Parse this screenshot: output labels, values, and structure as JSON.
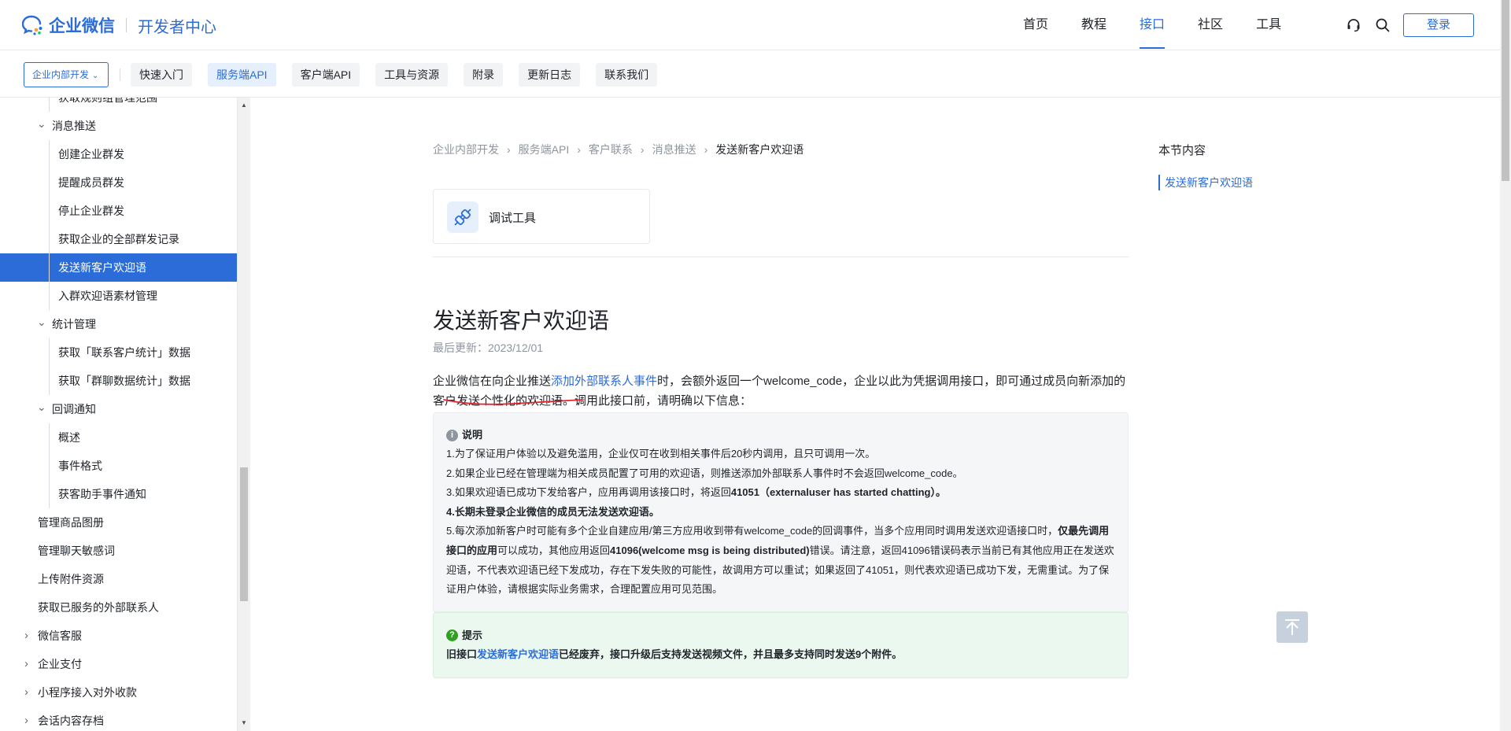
{
  "header": {
    "logo_text": "企业微信",
    "logo_sub": "开发者中心",
    "nav": [
      {
        "label": "首页"
      },
      {
        "label": "教程"
      },
      {
        "label": "接口"
      },
      {
        "label": "社区"
      },
      {
        "label": "工具"
      }
    ],
    "active_nav": "接口",
    "login_label": "登录",
    "accent_color": "#2b6cd8"
  },
  "subnav": {
    "dropdown_label": "企业内部开发",
    "items": [
      {
        "label": "快速入门"
      },
      {
        "label": "服务端API"
      },
      {
        "label": "客户端API"
      },
      {
        "label": "工具与资源"
      },
      {
        "label": "附录"
      },
      {
        "label": "更新日志"
      },
      {
        "label": "联系我们"
      }
    ],
    "active_item": "服务端API"
  },
  "sidebar": {
    "items": [
      {
        "label": "获取规则组管理范围",
        "level": 2,
        "caret": ""
      },
      {
        "label": "消息推送",
        "level": 1,
        "caret": "down"
      },
      {
        "label": "创建企业群发",
        "level": 2,
        "caret": ""
      },
      {
        "label": "提醒成员群发",
        "level": 2,
        "caret": ""
      },
      {
        "label": "停止企业群发",
        "level": 2,
        "caret": ""
      },
      {
        "label": "获取企业的全部群发记录",
        "level": 2,
        "caret": ""
      },
      {
        "label": "发送新客户欢迎语",
        "level": 2,
        "caret": "",
        "active": true
      },
      {
        "label": "入群欢迎语素材管理",
        "level": 2,
        "caret": ""
      },
      {
        "label": "统计管理",
        "level": 1,
        "caret": "down"
      },
      {
        "label": "获取「联系客户统计」数据",
        "level": 2,
        "caret": ""
      },
      {
        "label": "获取「群聊数据统计」数据",
        "level": 2,
        "caret": ""
      },
      {
        "label": "回调通知",
        "level": 1,
        "caret": "down"
      },
      {
        "label": "概述",
        "level": 2,
        "caret": ""
      },
      {
        "label": "事件格式",
        "level": 2,
        "caret": ""
      },
      {
        "label": "获客助手事件通知",
        "level": 2,
        "caret": ""
      },
      {
        "label": "管理商品图册",
        "level": 0,
        "caret": ""
      },
      {
        "label": "管理聊天敏感词",
        "level": 0,
        "caret": ""
      },
      {
        "label": "上传附件资源",
        "level": 0,
        "caret": ""
      },
      {
        "label": "获取已服务的外部联系人",
        "level": 0,
        "caret": ""
      },
      {
        "label": "微信客服",
        "level": -1,
        "caret": "right"
      },
      {
        "label": "企业支付",
        "level": -1,
        "caret": "right"
      },
      {
        "label": "小程序接入对外收款",
        "level": -1,
        "caret": "right"
      },
      {
        "label": "会话内容存档",
        "level": -1,
        "caret": "right"
      }
    ]
  },
  "breadcrumb": [
    {
      "label": "企业内部开发"
    },
    {
      "label": "服务端API"
    },
    {
      "label": "客户联系"
    },
    {
      "label": "消息推送"
    },
    {
      "label": "发送新客户欢迎语"
    }
  ],
  "debug_tool_label": "调试工具",
  "article": {
    "title": "发送新客户欢迎语",
    "updated": "最后更新：2023/12/01",
    "intro_1": "企业微信在向企业推送",
    "intro_link": "添加外部联系人事件",
    "intro_2": "时，会额外返回一个welcome_code，企业以此为凭据调用接口，即可通过成员向新添加的客户发送个性化的欢迎语。调用此接口前，请明确以下信息："
  },
  "note": {
    "title": "说明",
    "line1": "1.为了保证用户体验以及避免滥用，企业仅可在收到相关事件后20秒内调用，且只可调用一次。",
    "line2": "2.如果企业已经在管理端为相关成员配置了可用的欢迎语，则推送添加外部联系人事件时不会返回welcome_code。",
    "line3_a": "3.如果欢迎语已成功下发给客户，应用再调用该接口时，将返回",
    "line3_b": "41051（externaluser has started chatting）。",
    "line4": "4.长期未登录企业微信的成员无法发送欢迎语。",
    "line5_a": "5.每次添加新客户时可能有多个企业自建应用/第三方应用收到带有welcome_code的回调事件，当多个应用同时调用发送欢迎语接口时，",
    "line5_b": "仅最先调用接口的应用",
    "line5_c": "可以成功，其他应用返回",
    "line5_d": "41096(welcome msg is being distributed)",
    "line5_e": "错误。请注意，返回41096错误码表示当前已有其他应用正在发送欢迎语，不代表欢迎语已经下发成功，存在下发失败的可能性，故调用方可以重试；如果返回了41051，则代表欢迎语已成功下发，无需重试。为了保证用户体验，请根据实际业务需求，合理配置应用可见范围。"
  },
  "tip": {
    "title": "提示",
    "text_a": "旧接口",
    "link": "发送新客户欢迎语",
    "text_b": "已经废弃，接口升级后支持发送视频文件，并且最多支持同时发送9个附件。"
  },
  "toc": {
    "title": "本节内容",
    "item": "发送新客户欢迎语"
  }
}
